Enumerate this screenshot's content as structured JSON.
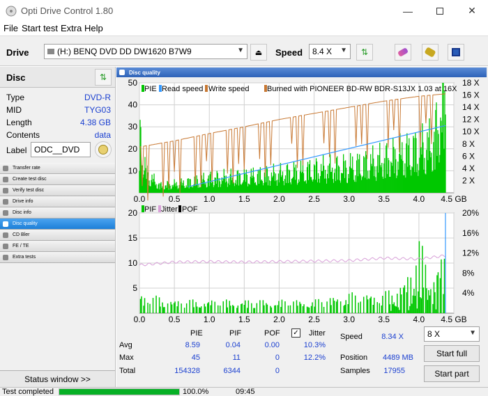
{
  "window": {
    "title": "Opti Drive Control 1.80"
  },
  "menu": [
    "File",
    "Start test",
    "Extra",
    "Help"
  ],
  "toolbar": {
    "drive_label": "Drive",
    "drive_value": "(H:)   BENQ DVD DD DW1620 B7W9",
    "speed_label": "Speed",
    "speed_value": "8.4 X"
  },
  "disc": {
    "header": "Disc",
    "rows": [
      {
        "label": "Type",
        "value": "DVD-R"
      },
      {
        "label": "MID",
        "value": "TYG03"
      },
      {
        "label": "Length",
        "value": "4.38 GB"
      },
      {
        "label": "Contents",
        "value": "data"
      }
    ],
    "label_label": "Label",
    "label_value": "ODC__DVD"
  },
  "nav": [
    "Transfer rate",
    "Create test disc",
    "Verify test disc",
    "Drive info",
    "Disc info",
    "Disc quality",
    "CD Bler",
    "FE / TE",
    "Extra tests"
  ],
  "nav_active": "Disc quality",
  "status_window_label": "Status window >>",
  "panel_title": "Disc quality",
  "legend_top": {
    "pie": "PIE",
    "read": "Read speed",
    "write": "Write speed",
    "burned": "Burned with PIONEER BD-RW  BDR-S13JX 1.03 at 16X"
  },
  "legend_bottom": {
    "pif": "PIF",
    "jitter": "Jitter",
    "pof": "POF"
  },
  "colors": {
    "pie": "#00c800",
    "read": "#3399ff",
    "write": "#c87832",
    "jitter": "#d8a0d8",
    "accent": "#1e7fd8"
  },
  "chart_data": [
    {
      "type": "area",
      "x_ticks": [
        "0.0",
        "0.5",
        "1.0",
        "1.5",
        "2.0",
        "2.5",
        "3.0",
        "3.5",
        "4.0",
        "4.5 GB"
      ],
      "xlim": [
        0,
        4.5
      ],
      "y_left_ticks": [
        "50",
        "40",
        "30",
        "20",
        "10"
      ],
      "ylim_left": [
        0,
        50
      ],
      "y_right_ticks": [
        "18 X",
        "16 X",
        "14 X",
        "12 X",
        "10 X",
        "8 X",
        "6 X",
        "4 X",
        "2 X"
      ],
      "ylim_right": [
        0,
        18
      ],
      "series": [
        {
          "name": "PIE",
          "x": [
            0,
            0.1,
            0.3,
            0.6,
            1.0,
            1.5,
            2.0,
            2.5,
            3.0,
            3.5,
            3.8,
            4.0,
            4.2,
            4.38
          ],
          "values": [
            25,
            8,
            3,
            4,
            6,
            7,
            8,
            10,
            11,
            14,
            17,
            19,
            21,
            40
          ]
        },
        {
          "name": "Read speed",
          "x": [
            0.7,
            4.38
          ],
          "values": [
            1,
            11
          ]
        },
        {
          "name": "Write speed",
          "x": [
            0,
            0.5,
            1.0,
            1.5,
            2.0,
            2.5,
            3.0,
            3.5,
            4.0,
            4.38
          ],
          "values": [
            7.5,
            8.5,
            9.7,
            10.8,
            12,
            13,
            14,
            15,
            15.8,
            16.2
          ]
        }
      ]
    },
    {
      "type": "bar",
      "x_ticks": [
        "0.0",
        "0.5",
        "1.0",
        "1.5",
        "2.0",
        "2.5",
        "3.0",
        "3.5",
        "4.0",
        "4.5 GB"
      ],
      "xlim": [
        0,
        4.5
      ],
      "y_left_ticks": [
        "20",
        "15",
        "10",
        "5"
      ],
      "ylim_left": [
        0,
        20
      ],
      "y_right_ticks": [
        "20%",
        "16%",
        "12%",
        "8%",
        "4%"
      ],
      "ylim_right": [
        0,
        20
      ],
      "series": [
        {
          "name": "PIF",
          "x": [
            0,
            0.5,
            1.0,
            1.5,
            2.0,
            2.5,
            3.0,
            3.5,
            3.8,
            4.0,
            4.2,
            4.38
          ],
          "values": [
            3,
            2,
            2,
            2,
            2,
            2,
            3,
            3,
            5,
            11,
            6,
            10
          ]
        },
        {
          "name": "Jitter",
          "x": [
            0,
            0.5,
            1.0,
            1.5,
            2.0,
            2.5,
            3.0,
            3.5,
            4.0,
            4.38
          ],
          "values": [
            9.6,
            10.2,
            10.3,
            10.2,
            10.3,
            10.4,
            10.5,
            11.0,
            10.8,
            11.5
          ]
        }
      ]
    }
  ],
  "stats": {
    "headers": [
      "PIE",
      "PIF",
      "POF",
      "Jitter"
    ],
    "rows": [
      {
        "label": "Avg",
        "pie": "8.59",
        "pif": "0.04",
        "pof": "0.00",
        "jitter": "10.3%"
      },
      {
        "label": "Max",
        "pie": "45",
        "pif": "11",
        "pof": "0",
        "jitter": "12.2%"
      },
      {
        "label": "Total",
        "pie": "154328",
        "pif": "6344",
        "pof": "0"
      }
    ],
    "speed_label": "Speed",
    "speed_value": "8.34 X",
    "position_label": "Position",
    "position_value": "4489 MB",
    "samples_label": "Samples",
    "samples_value": "17955",
    "speed_select": "8 X",
    "start_full": "Start full",
    "start_part": "Start part"
  },
  "status": {
    "text": "Test completed",
    "progress": 100,
    "percent": "100.0%",
    "time": "09:45"
  }
}
